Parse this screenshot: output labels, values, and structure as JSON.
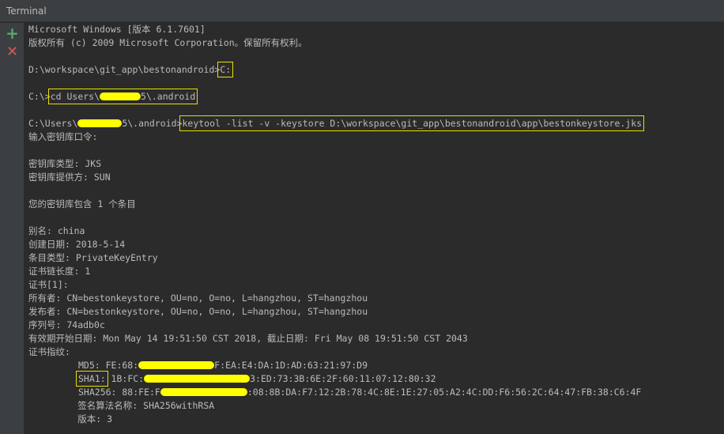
{
  "window": {
    "title": "Terminal"
  },
  "toolbar": {
    "add_icon": "plus-icon",
    "close_icon": "close-icon"
  },
  "lines": [
    "Microsoft Windows [版本 6.1.7601]",
    "版权所有 (c) 2009 Microsoft Corporation。保留所有权利。",
    "",
    "",
    "",
    "",
    "",
    "输入密钥库口令:",
    "",
    "密钥库类型: JKS",
    "密钥库提供方: SUN",
    "",
    "您的密钥库包含 1 个条目",
    "",
    "别名: china",
    "创建日期: 2018-5-14",
    "条目类型: PrivateKeyEntry",
    "证书链长度: 1",
    "证书[1]:",
    "所有者: CN=bestonkeystore, OU=no, O=no, L=hangzhou, ST=hangzhou",
    "发布者: CN=bestonkeystore, OU=no, O=no, L=hangzhou, ST=hangzhou",
    "序列号: 74adb0c",
    "有效期开始日期: Mon May 14 19:51:50 CST 2018, 截止日期: Fri May 08 19:51:50 CST 2043",
    "证书指纹:",
    "",
    "",
    "",
    "         签名算法名称: SHA256withRSA",
    "         版本: 3"
  ],
  "commands": {
    "c1_prompt": "D:\\workspace\\git_app\\bestonandroid>",
    "c1_cmd": "C:",
    "c2_prompt": "C:\\>",
    "c2_cmd_a": "cd Users\\",
    "c2_cmd_b": "5\\.android",
    "c3_prompt_a": "C:\\Users\\",
    "c3_prompt_b": "5\\.android>",
    "c3_cmd": "keytool -list -v -keystore D:\\workspace\\git_app\\bestonandroid\\app\\bestonkeystore.jks"
  },
  "fingerprints": {
    "md5_a": "MD5: FE:68:",
    "md5_b": "F:EA:E4:DA:1D:AD:63:21:97:D9",
    "sha1_label": "SHA1:",
    "sha1_a": " 1B:FC:",
    "sha1_b": "3:ED:73:3B:6E:2F:60:11:07:12:80:32",
    "sha256_a": "SHA256: 88:FE:F",
    "sha256_b": ":08:8B:DA:F7:12:2B:78:4C:8E:1E:27:05:A2:4C:DD:F6:56:2C:64:47:FB:38:C6:4F"
  },
  "colors": {
    "background": "#2b2b2b",
    "text": "#bbbbbb",
    "highlight": "#e8e000",
    "redaction": "#ffff00"
  }
}
